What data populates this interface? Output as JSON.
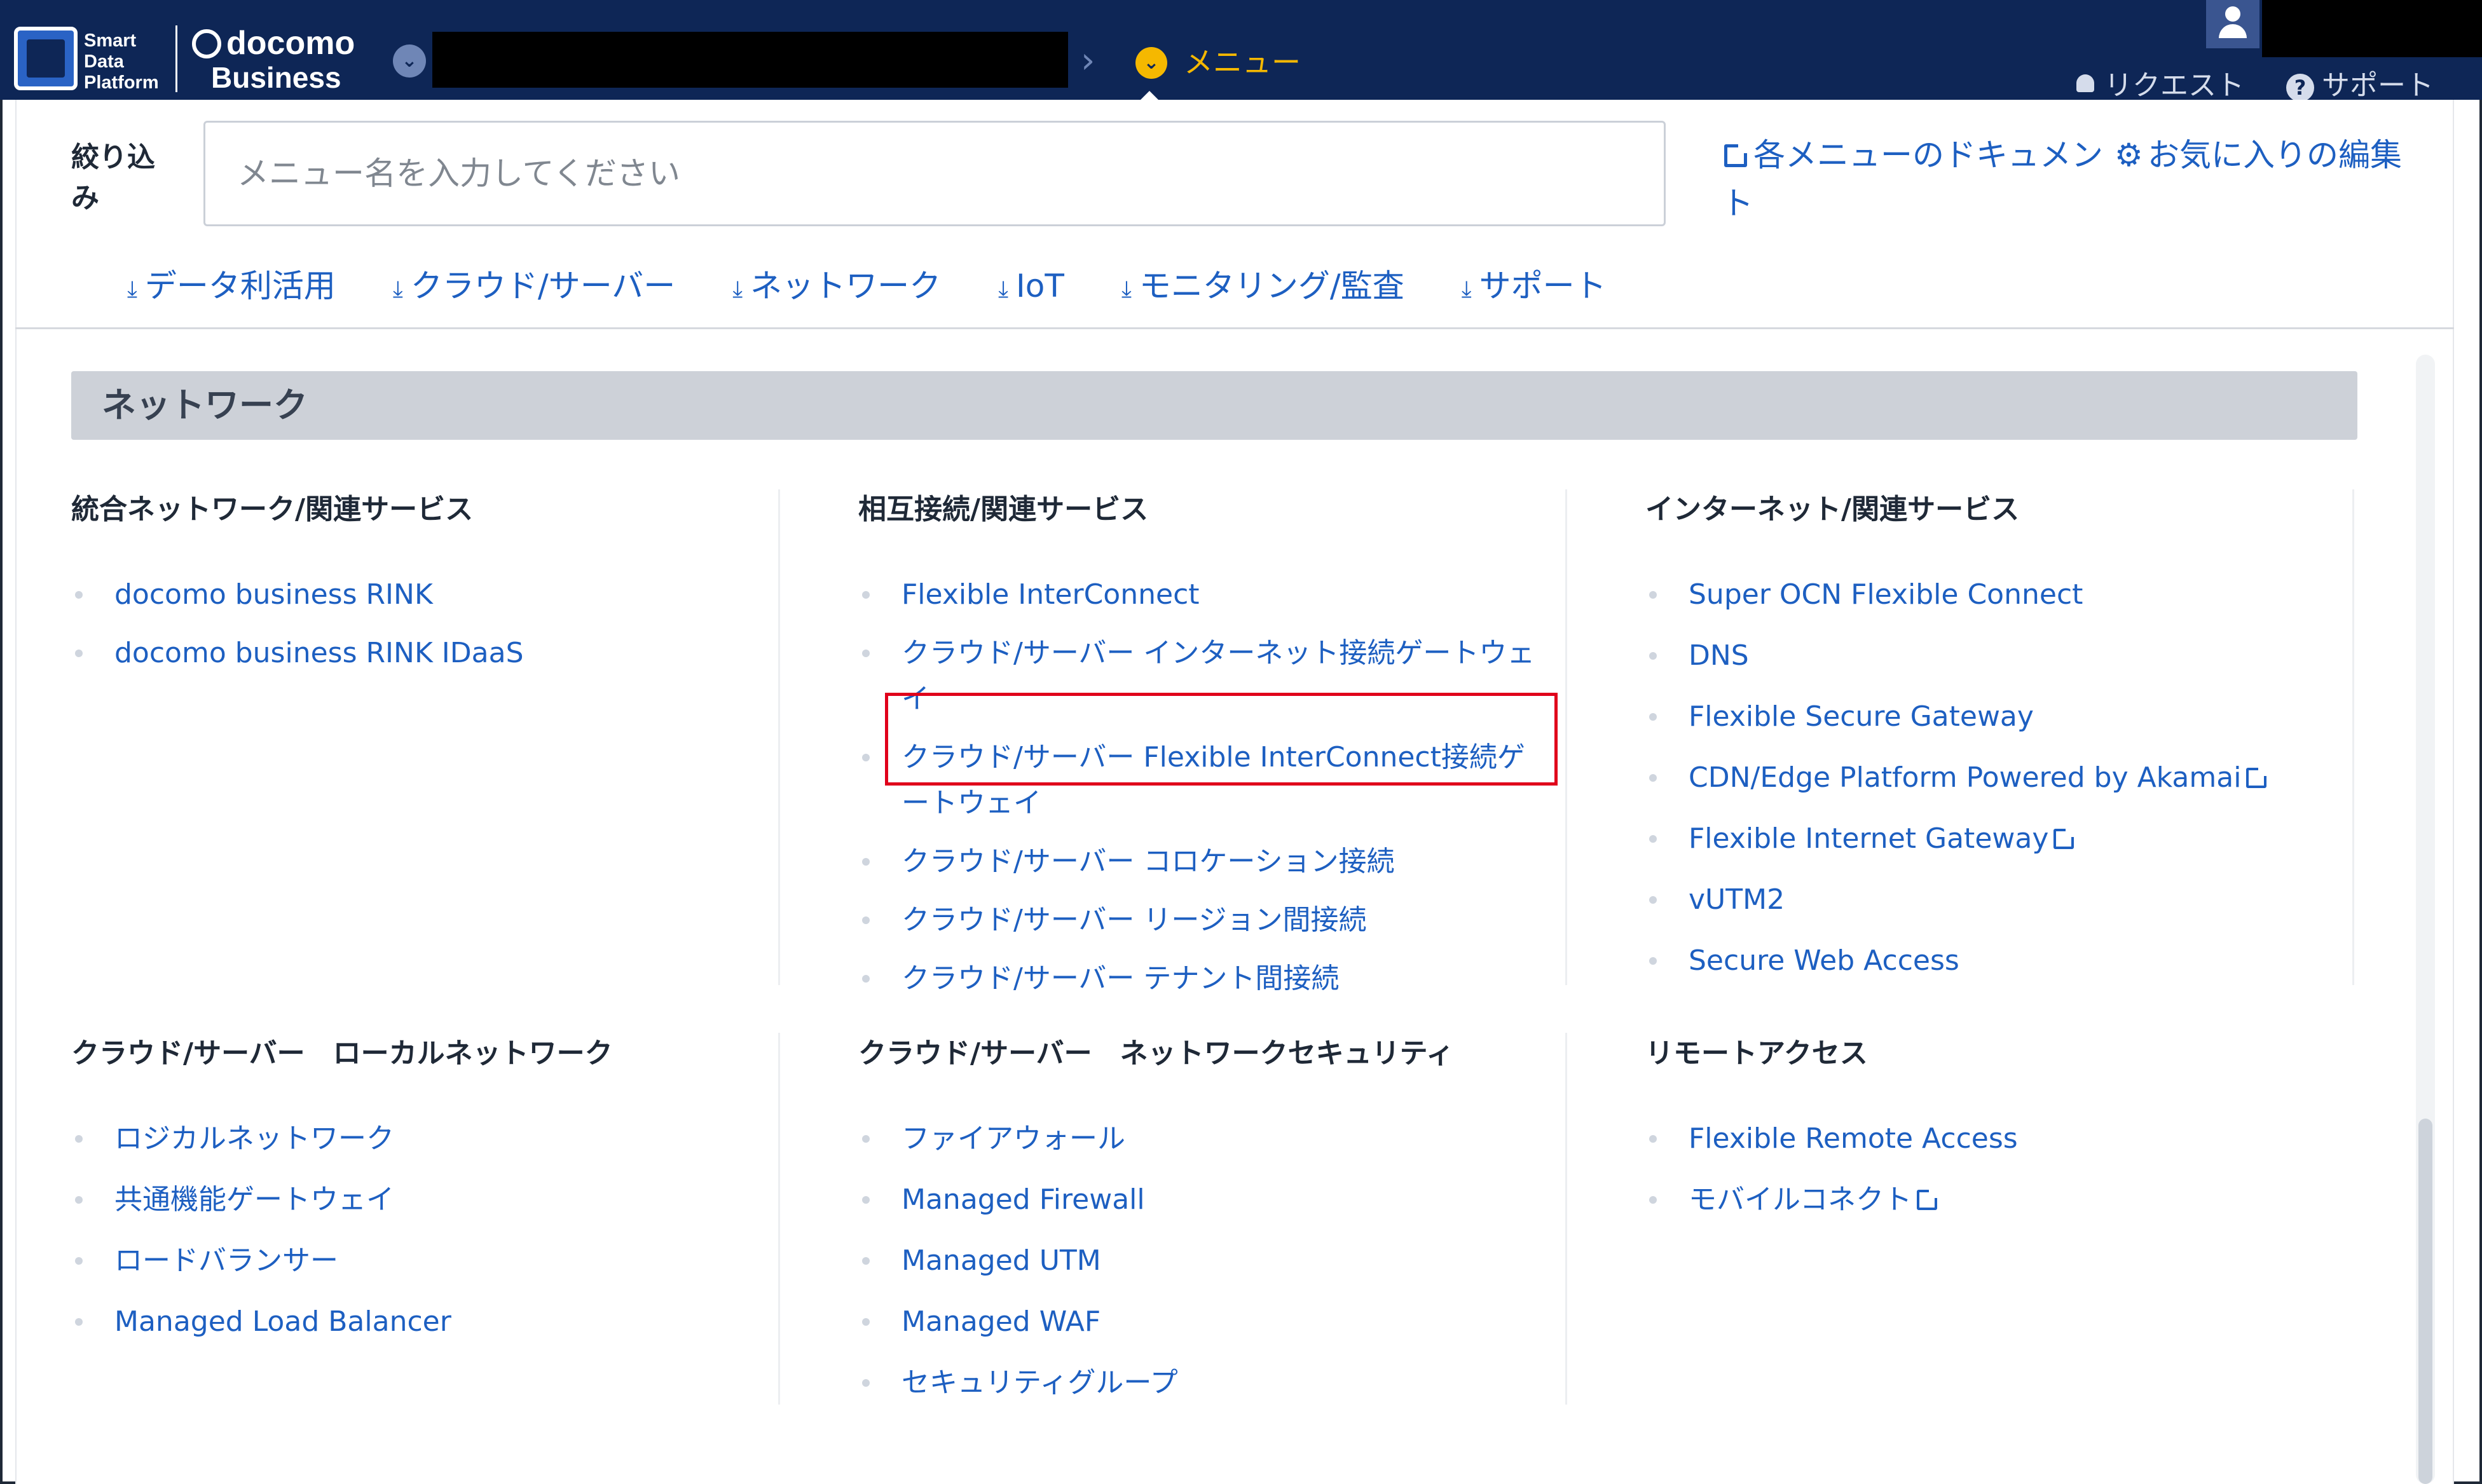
{
  "header": {
    "logo_lines": [
      "Smart",
      "Data",
      "Platform"
    ],
    "brand_docomo": "docomo",
    "brand_business": "Business",
    "tenant_toggle_icon": "chevron-down",
    "breadcrumb_separator": "›",
    "menu_label": "メニュー",
    "menu_toggle_icon": "chevron-down",
    "request_label": "リクエスト",
    "support_label": "サポート",
    "colors": {
      "bar": "#0e2656",
      "accent": "#f5b800"
    }
  },
  "filter": {
    "label": "絞り込み",
    "placeholder": "メニュー名を入力してください"
  },
  "links": {
    "docs": "各メニューのドキュメント",
    "favorites": "お気に入りの編集"
  },
  "categories": [
    "データ利活用",
    "クラウド/サーバー",
    "ネットワーク",
    "IoT",
    "モニタリング/監査",
    "サポート"
  ],
  "section": {
    "title": "ネットワーク",
    "groups": [
      {
        "title": "統合ネットワーク/関連サービス",
        "items": [
          "docomo business RINK",
          "docomo business RINK IDaaS"
        ]
      },
      {
        "title": "相互接続/関連サービス",
        "items": [
          "Flexible InterConnect",
          "クラウド/サーバー インターネット接続ゲートウェイ",
          "クラウド/サーバー Flexible InterConnect接続ゲートウェイ",
          "クラウド/サーバー コロケーション接続",
          "クラウド/サーバー リージョン間接続",
          "クラウド/サーバー テナント間接続"
        ]
      },
      {
        "title": "インターネット/関連サービス",
        "items": [
          "Super OCN Flexible Connect",
          "DNS",
          "Flexible Secure Gateway",
          "CDN/Edge Platform Powered by Akamai",
          "Flexible Internet Gateway",
          "vUTM2",
          "Secure Web Access"
        ]
      },
      {
        "title": "クラウド/サーバー　ローカルネットワーク",
        "items": [
          "ロジカルネットワーク",
          "共通機能ゲートウェイ",
          "ロードバランサー",
          "Managed Load Balancer"
        ]
      },
      {
        "title": "クラウド/サーバー　ネットワークセキュリティ",
        "items": [
          "ファイアウォール",
          "Managed Firewall",
          "Managed UTM",
          "Managed WAF",
          "セキュリティグループ"
        ]
      },
      {
        "title": "リモートアクセス",
        "items": [
          "Flexible Remote Access",
          "モバイルコネクト"
        ]
      }
    ]
  },
  "colors": {
    "link": "#1d5fc1",
    "highlight": "#e0001b"
  }
}
